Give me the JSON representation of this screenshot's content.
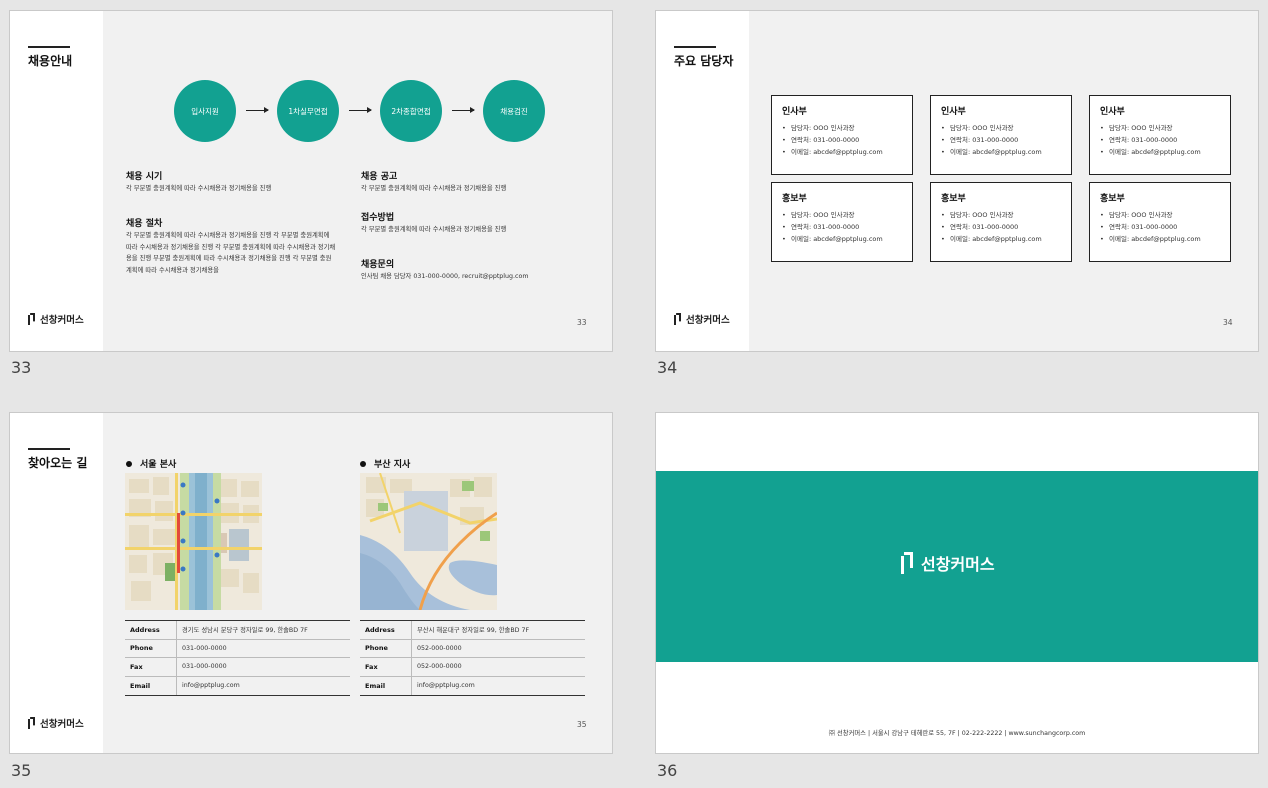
{
  "slides": [
    {
      "number": "33",
      "title": "채용안내",
      "steps": [
        "입사지원",
        "1차실무면접",
        "2차종합면접",
        "채용검진"
      ],
      "sections_left": [
        {
          "heading": "채용 시기",
          "text": "각 부분별 충원계획에 따라 수시채용과 정기채용을 진행"
        },
        {
          "heading": "채용 절차",
          "text": "각 부분별 충원계획에 따라 수시채용과 정기채용을 진행 각 부분별 충원계획에 따라 수시채용과 정기채용을 진행 각 부분별 충원계획에 따라 수시채용과 정기채용을 진행 부분별 충원계획에 따라 수시채용과 정기채용을 진행 각 부분별 충원계획에 따라 수시채용과 정기채용을"
        }
      ],
      "sections_right": [
        {
          "heading": "채용 공고",
          "text": "각 부분별 충원계획에 따라 수시채용과 정기채용을 진행"
        },
        {
          "heading": "접수방법",
          "text": "각 부분별 충원계획에 따라 수시채용과 정기채용을 진행"
        },
        {
          "heading": "채용문의",
          "text": "인사팀 채용 담당자 031-000-0000, recruit@pptplug.com"
        }
      ],
      "logo": "선창커머스",
      "page": "33"
    },
    {
      "number": "34",
      "title": "주요 담당자",
      "cards": [
        {
          "dept": "인사부",
          "lines": [
            "담당자: OOO 인사과장",
            "연락처: 031-000-0000",
            "이메일: abcdef@pptplug.com"
          ]
        },
        {
          "dept": "인사부",
          "lines": [
            "담당자: OOO 인사과장",
            "연락처: 031-000-0000",
            "이메일: abcdef@pptplug.com"
          ]
        },
        {
          "dept": "인사부",
          "lines": [
            "담당자: OOO 인사과장",
            "연락처: 031-000-0000",
            "이메일: abcdef@pptplug.com"
          ]
        },
        {
          "dept": "홍보부",
          "lines": [
            "담당자: OOO 인사과장",
            "연락처: 031-000-0000",
            "이메일: abcdef@pptplug.com"
          ]
        },
        {
          "dept": "홍보부",
          "lines": [
            "담당자: OOO 인사과장",
            "연락처: 031-000-0000",
            "이메일: abcdef@pptplug.com"
          ]
        },
        {
          "dept": "홍보부",
          "lines": [
            "담당자: OOO 인사과장",
            "연락처: 031-000-0000",
            "이메일: abcdef@pptplug.com"
          ]
        }
      ],
      "logo": "선창커머스",
      "page": "34"
    },
    {
      "number": "35",
      "title": "찾아오는 길",
      "offices": [
        {
          "name": "서울 본사",
          "rows": [
            {
              "k": "Address",
              "v": "경기도 성남시 분당구 정자일로 99, 한솔BD 7F"
            },
            {
              "k": "Phone",
              "v": "031-000-0000"
            },
            {
              "k": "Fax",
              "v": "031-000-0000"
            },
            {
              "k": "Email",
              "v": "info@pptplug.com"
            }
          ]
        },
        {
          "name": "부산 지사",
          "rows": [
            {
              "k": "Address",
              "v": "부산시 해운대구 정자일로 99, 한솔BD 7F"
            },
            {
              "k": "Phone",
              "v": "052-000-0000"
            },
            {
              "k": "Fax",
              "v": "052-000-0000"
            },
            {
              "k": "Email",
              "v": "info@pptplug.com"
            }
          ]
        }
      ],
      "logo": "선창커머스",
      "page": "35"
    },
    {
      "number": "36",
      "logo": "선창커머스",
      "footer": "㈜ 선창커머스 | 서울시 강남구 테헤란로 55, 7F | 02-222-2222 | www.sunchangcorp.com"
    }
  ],
  "colors": {
    "accent": "#12a191",
    "background": "#e6e6e6",
    "slide_bg": "#f1f1f1"
  }
}
